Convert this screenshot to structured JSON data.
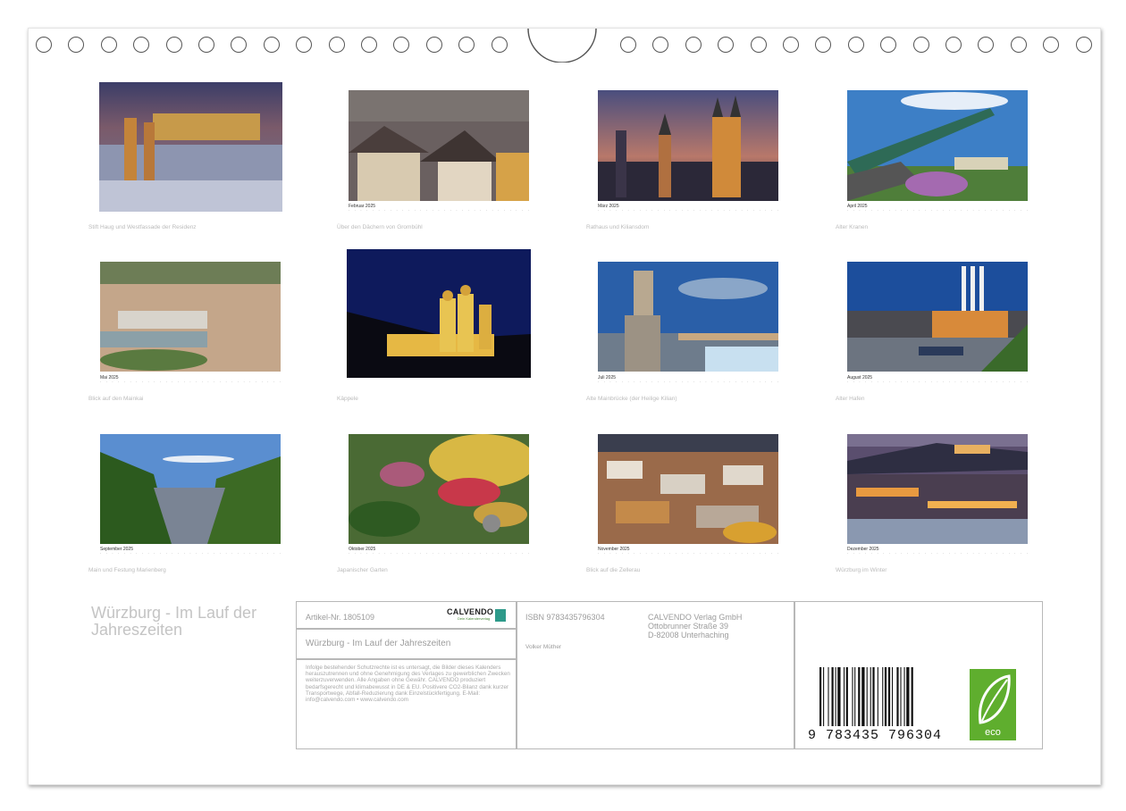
{
  "calendar_title": "Würzburg - Im Lauf der Jahreszeiten",
  "months": [
    {
      "caption": "Stift Haug und Westfassade der Residenz",
      "month": ""
    },
    {
      "caption": "Über den Dächern von Grombühl",
      "month": "Februar 2025"
    },
    {
      "caption": "Rathaus und Kiliansdom",
      "month": "März 2025"
    },
    {
      "caption": "Alter Kranen",
      "month": "April 2025"
    },
    {
      "caption": "Blick auf den Mainkai",
      "month": "Mai 2025"
    },
    {
      "caption": "Käppele",
      "month": ""
    },
    {
      "caption": "Alte Mainbrücke (der Heilige Kilian)",
      "month": "Juli 2025"
    },
    {
      "caption": "Alter Hafen",
      "month": "August 2025"
    },
    {
      "caption": "Main und Festung Marienberg",
      "month": "September 2025"
    },
    {
      "caption": "Japanischer Garten",
      "month": "Oktober 2025"
    },
    {
      "caption": "Blick auf die Zellerau",
      "month": "November 2025"
    },
    {
      "caption": "Würzburg im Winter",
      "month": "Dezember 2025"
    }
  ],
  "info": {
    "article": "Artikel-Nr. 1805109",
    "publisher_logo": "CALVENDO",
    "publisher_logo_sub": "Dein Kalenderverlag",
    "box_title": "Würzburg - Im Lauf der Jahreszeiten",
    "legal": "Infolge bestehender Schutzrechte ist es untersagt, die Bilder dieses Kalenders herauszutrennen und ohne Genehmigung des Verlages zu gewerblichen Zwecken weiterzuverwenden. Alle Angaben ohne Gewähr. CALVENDO produziert bedarfsgerecht und klimabewusst in DE & EU. Positivere CO2-Bilanz dank kurzer Transportwege, Abfall-Reduzierung dank Einzelstückfertigung. E-Mail: info@calvendo.com • www.calvendo.com",
    "isbn": "ISBN 9783435796304",
    "author": "Volker Müther",
    "publisher_name": "CALVENDO Verlag GmbH",
    "publisher_street": "Ottobrunner Straße 39",
    "publisher_city": "D-82008 Unterhaching",
    "ean": "9 783435 796304",
    "eco_label": "eco"
  }
}
